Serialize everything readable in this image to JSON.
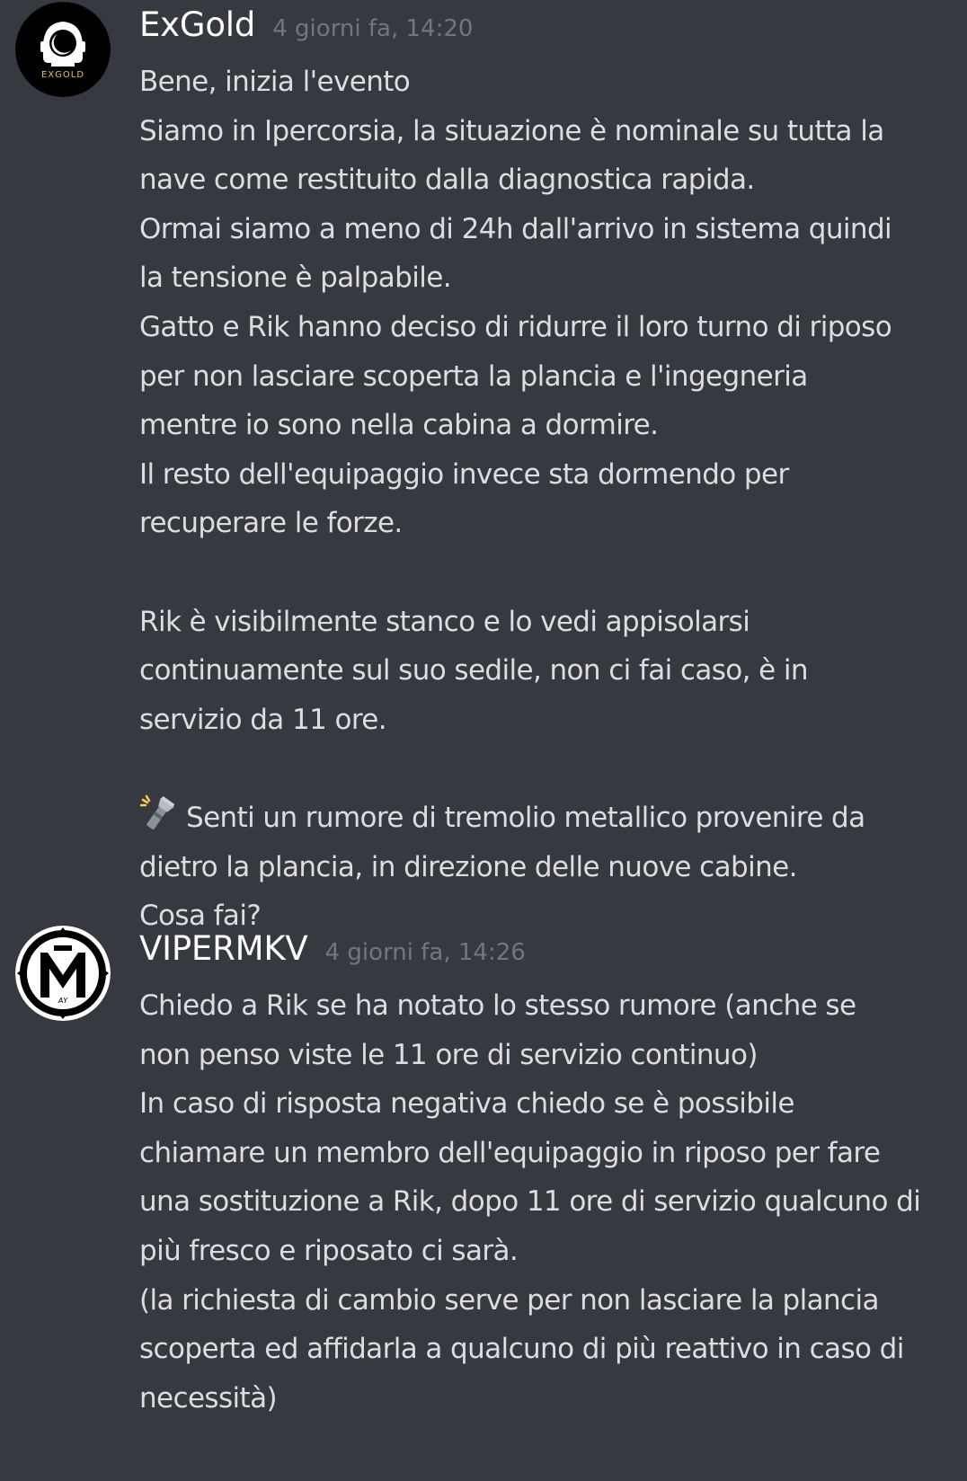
{
  "messages": [
    {
      "author": "ExGold",
      "timestamp": "4 giorni fa, 14:20",
      "avatar_icon": "exgold-astronaut-helmet-icon",
      "avatar_text": "EXGOLD",
      "lines": [
        "Bene, inizia l'evento",
        "Siamo in Ipercorsia, la situazione è nominale su tutta la",
        "nave come restituito dalla diagnostica rapida.",
        "Ormai siamo a meno di 24h dall'arrivo in sistema quindi",
        "la tensione è palpabile.",
        "Gatto e Rik hanno deciso di ridurre il loro turno di riposo",
        "per non lasciare scoperta la plancia e l'ingegneria",
        "mentre io sono nella cabina a dormire.",
        "Il resto dell'equipaggio invece sta dormendo per",
        "recuperare le forze.",
        "",
        "Rik è visibilmente stanco e lo vedi appisolarsi",
        "continuamente sul suo sedile, non ci fai caso, è in",
        "servizio da 11 ore.",
        "",
        "Senti un rumore di tremolio metallico provenire da",
        "dietro la plancia, in direzione delle nuove cabine.",
        "Cosa fai?"
      ],
      "emoji_icon": "flashlight-icon"
    },
    {
      "author": "VIPERMKV",
      "timestamp": "4 giorni fa, 14:26",
      "avatar_icon": "vipermkv-m-logo-icon",
      "lines": [
        "Chiedo a Rik se ha notato lo stesso rumore (anche se",
        "non penso viste le 11 ore di servizio continuo)",
        "In caso di risposta negativa chiedo se è possibile",
        "chiamare un membro dell'equipaggio in riposo per fare",
        "una sostituzione a Rik, dopo 11 ore di servizio qualcuno di",
        "più fresco e riposato ci sarà.",
        "(la richiesta di cambio serve per non lasciare la plancia",
        "scoperta ed affidarla a qualcuno di più reattivo in caso di",
        "necessità)"
      ]
    }
  ],
  "colors": {
    "background": "#36393f",
    "username": "#ffffff",
    "timestamp": "#72767d",
    "text": "#dcddde",
    "exgold_accent": "#f0c14b"
  }
}
